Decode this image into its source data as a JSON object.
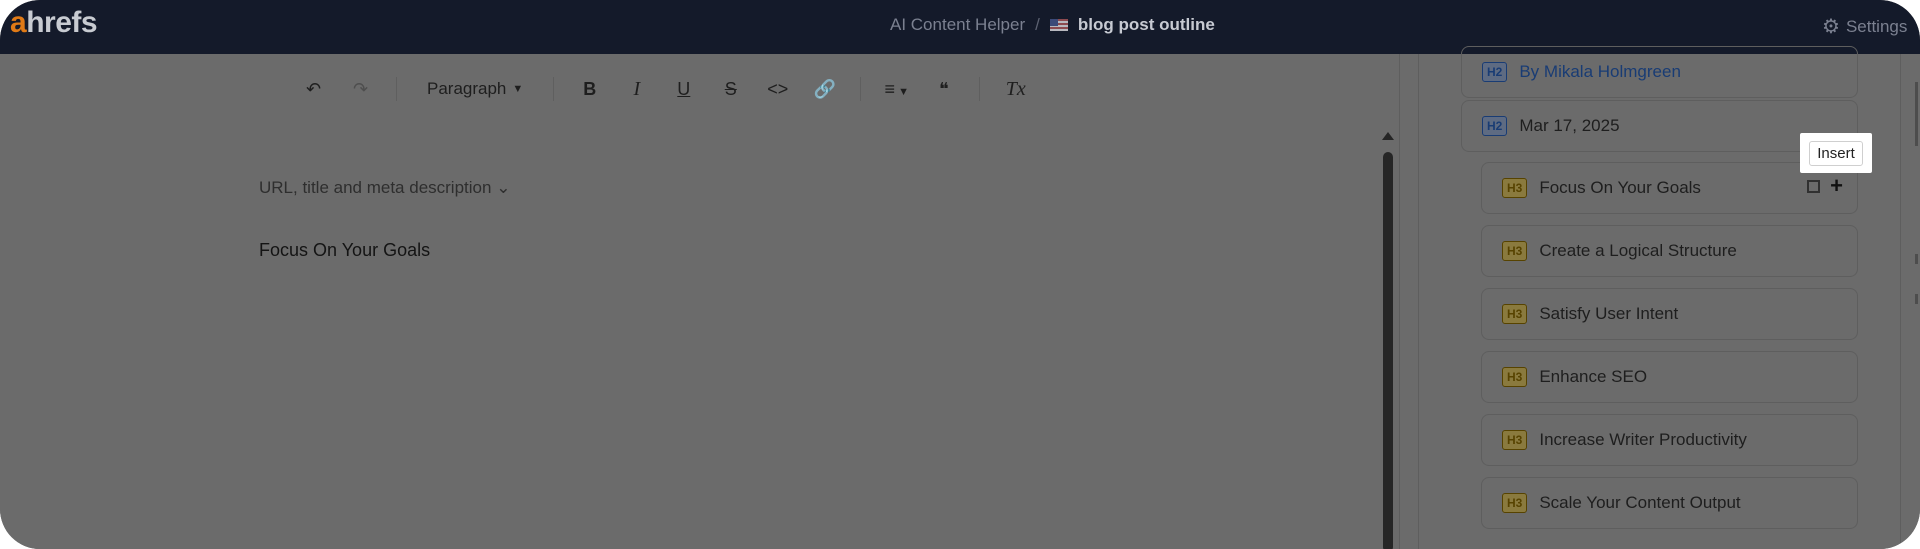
{
  "header": {
    "logo_prefix": "a",
    "logo_rest": "hrefs",
    "breadcrumb_parent": "AI Content Helper",
    "breadcrumb_separator": "/",
    "document_title": "blog post outline",
    "settings_label": "Settings"
  },
  "toolbar": {
    "undo": "↶",
    "redo": "↷",
    "paragraph_label": "Paragraph",
    "bold": "B",
    "italic": "I",
    "underline": "U",
    "strikethrough": "S",
    "code": "<>",
    "link": "🔗",
    "align": "≡",
    "quote": "❝",
    "clear_format": "Tx"
  },
  "editor": {
    "meta_toggle": "URL, title and meta description",
    "content_line": "Focus On Your Goals"
  },
  "outline": {
    "items": [
      {
        "level": "H2",
        "text": "By Mikala Holmgreen"
      },
      {
        "level": "H2",
        "text": "Mar 17, 2025"
      },
      {
        "level": "H3",
        "text": "Focus On Your Goals"
      },
      {
        "level": "H3",
        "text": "Create a Logical Structure"
      },
      {
        "level": "H3",
        "text": "Satisfy User Intent"
      },
      {
        "level": "H3",
        "text": "Enhance SEO"
      },
      {
        "level": "H3",
        "text": "Increase Writer Productivity"
      },
      {
        "level": "H3",
        "text": "Scale Your Content Output"
      }
    ],
    "insert_tooltip": "Insert"
  },
  "icons": [
    "gear-icon",
    "flag-icon",
    "undo-icon",
    "redo-icon",
    "chevron-down-icon",
    "copy-icon",
    "plus-icon"
  ],
  "colors": {
    "header_bg": "#141a2a",
    "brand_orange": "#e07a16",
    "h2_tag": "#193c74",
    "h3_tag": "#574300"
  }
}
